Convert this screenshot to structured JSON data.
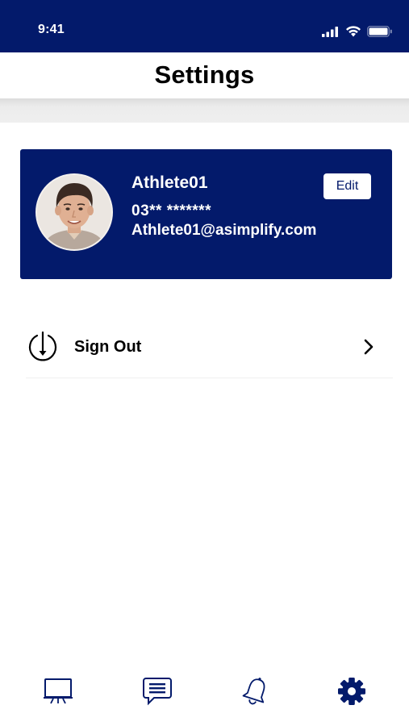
{
  "status_bar": {
    "time": "9:41",
    "signal_icon": "cellular-signal-icon",
    "wifi_icon": "wifi-icon",
    "battery_icon": "battery-icon"
  },
  "header": {
    "title": "Settings"
  },
  "profile": {
    "name": "Athlete01",
    "phone": "03** *******",
    "email": "Athlete01@asimplify.com",
    "edit_label": "Edit",
    "avatar_icon": "user-avatar"
  },
  "menu": {
    "items": [
      {
        "label": "Sign Out",
        "icon": "sign-out-icon",
        "chevron_icon": "chevron-right-icon"
      }
    ]
  },
  "tab_bar": {
    "tabs": [
      {
        "icon": "presentation-board-icon",
        "active": false
      },
      {
        "icon": "chat-message-icon",
        "active": false
      },
      {
        "icon": "bell-icon",
        "active": false
      },
      {
        "icon": "gear-icon",
        "active": true
      }
    ]
  },
  "colors": {
    "primary": "#031a6b",
    "background": "#ffffff",
    "text": "#000000",
    "card_text": "#ffffff"
  }
}
